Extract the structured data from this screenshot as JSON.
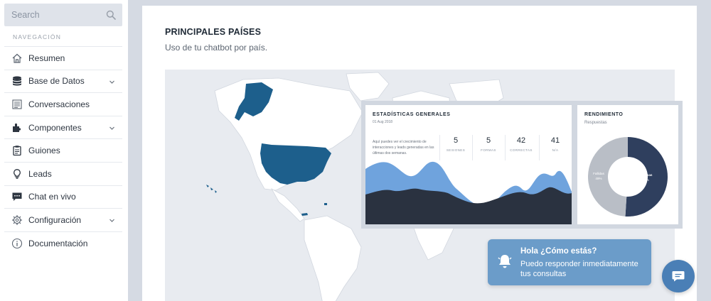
{
  "sidebar": {
    "search_placeholder": "Search",
    "heading": "NAVEGACIÓN",
    "items": [
      {
        "label": "Resumen",
        "icon": "home-icon",
        "expandable": false
      },
      {
        "label": "Base de Datos",
        "icon": "database-icon",
        "expandable": true
      },
      {
        "label": "Conversaciones",
        "icon": "list-icon",
        "expandable": false
      },
      {
        "label": "Componentes",
        "icon": "puzzle-icon",
        "expandable": true
      },
      {
        "label": "Guiones",
        "icon": "clipboard-icon",
        "expandable": false
      },
      {
        "label": "Leads",
        "icon": "lightbulb-icon",
        "expandable": false
      },
      {
        "label": "Chat en vivo",
        "icon": "chat-icon",
        "expandable": false
      },
      {
        "label": "Configuración",
        "icon": "gear-icon",
        "expandable": true
      },
      {
        "label": "Documentación",
        "icon": "info-icon",
        "expandable": false
      }
    ]
  },
  "main": {
    "title": "PRINCIPALES PAÍSES",
    "subtitle": "Uso de tu chatbot por país.",
    "map_highlight_color": "#1d5f8c",
    "map_land_color": "#ffffff"
  },
  "stats": {
    "title": "ESTADÍSTICAS GENERALES",
    "date": "01 Aug 2018",
    "description": "Aquí puedes ver el crecimiento de interacciones y leads generadas en las últimas dos semanas.",
    "metrics": [
      {
        "value": "5",
        "label": "SESIONES"
      },
      {
        "value": "5",
        "label": "FORMAS"
      },
      {
        "value": "42",
        "label": "CORRECTAS"
      },
      {
        "value": "41",
        "label": "N/A"
      }
    ],
    "colors": {
      "front": "#2a3240",
      "back": "#6fa3dd"
    }
  },
  "performance": {
    "title": "RENDIMIENTO",
    "subtitle": "Respuestas",
    "segments": [
      {
        "name": "Exitosas",
        "percent": 51,
        "label": "51%",
        "color": "#2f3f5e"
      },
      {
        "name": "Fallidas",
        "percent": 49,
        "label": "49%",
        "color": "#b9bec6"
      }
    ]
  },
  "chat": {
    "greeting": "Hola ¿Cómo estás?",
    "message": "Puedo responder inmediatamente tus consultas",
    "bubble_color": "#6b9cc9",
    "fab_color": "#4a7fb6"
  }
}
